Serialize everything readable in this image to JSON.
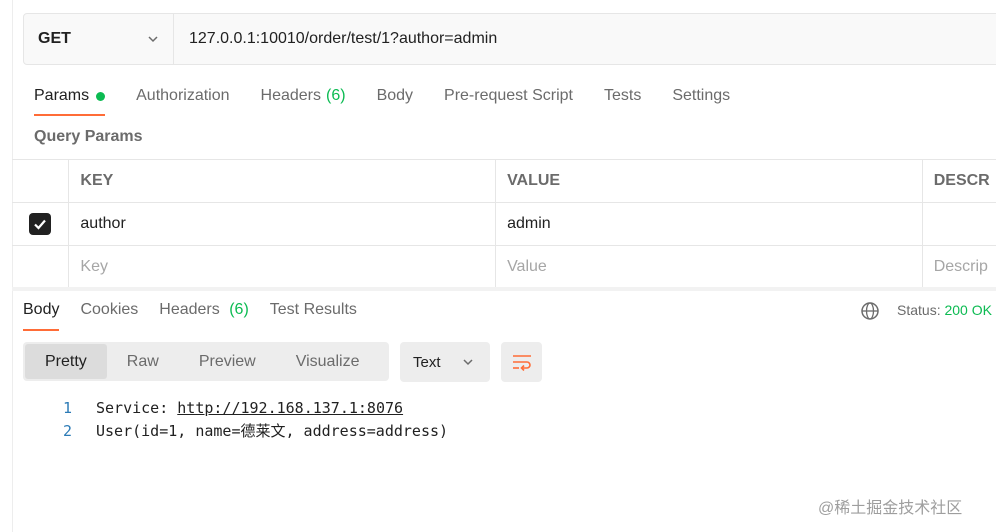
{
  "request": {
    "method": "GET",
    "url": "127.0.0.1:10010/order/test/1?author=admin"
  },
  "request_tabs": [
    {
      "label": "Params",
      "count": ""
    },
    {
      "label": "Authorization",
      "count": ""
    },
    {
      "label": "Headers",
      "count": "(6)"
    },
    {
      "label": "Body",
      "count": ""
    },
    {
      "label": "Pre-request Script",
      "count": ""
    },
    {
      "label": "Tests",
      "count": ""
    },
    {
      "label": "Settings",
      "count": ""
    }
  ],
  "query_params": {
    "title": "Query Params",
    "columns": [
      "KEY",
      "VALUE",
      "DESCR"
    ],
    "rows": [
      {
        "checked": true,
        "key": "author",
        "value": "admin",
        "description": ""
      }
    ],
    "placeholder": {
      "key": "Key",
      "value": "Value",
      "description": "Descrip"
    }
  },
  "response_tabs": [
    {
      "label": "Body",
      "count": ""
    },
    {
      "label": "Cookies",
      "count": ""
    },
    {
      "label": "Headers",
      "count": "(6)"
    },
    {
      "label": "Test Results",
      "count": ""
    }
  ],
  "status": {
    "label": "Status:",
    "value": "200 OK"
  },
  "view_modes": [
    "Pretty",
    "Raw",
    "Preview",
    "Visualize"
  ],
  "format": "Text",
  "code_lines": [
    {
      "num": "1",
      "prefix": "Service: ",
      "link": "http://192.168.137.1:8076"
    },
    {
      "num": "2",
      "prefix": "User(id=1, name=德莱文, address=address)",
      "link": ""
    }
  ],
  "watermark": "@稀土掘金技术社区",
  "colors": {
    "accent": "#ff6c37",
    "success": "#0cbb52",
    "line_number": "#2c7bb6"
  }
}
